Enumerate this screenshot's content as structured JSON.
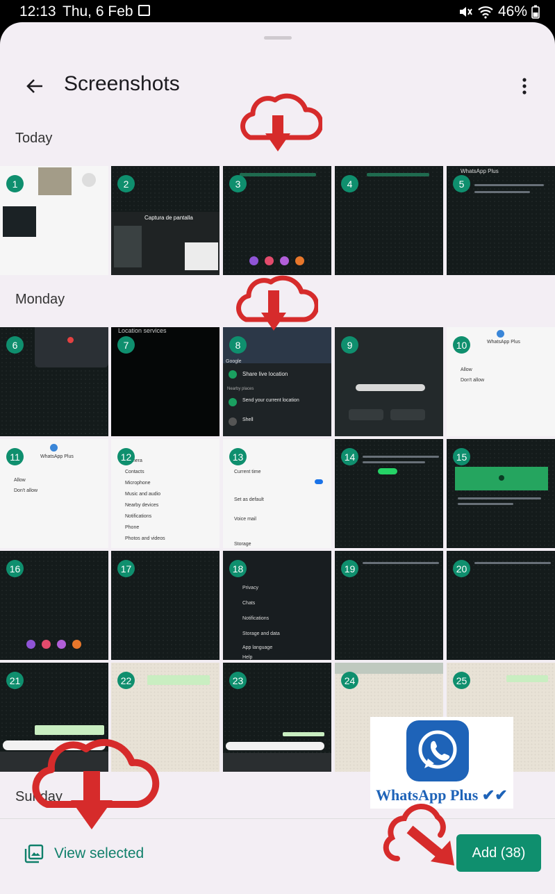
{
  "status_bar": {
    "time": "12:13",
    "date": "Thu, 6 Feb",
    "battery": "46%",
    "icons": [
      "gallery-icon",
      "mute-icon",
      "wifi-icon",
      "battery-icon"
    ]
  },
  "header": {
    "title": "Screenshots",
    "back_icon": "arrow-left-icon",
    "menu_icon": "more-vertical-icon"
  },
  "sections": [
    {
      "label": "Today"
    },
    {
      "label": "Monday"
    },
    {
      "label": "Sunday"
    }
  ],
  "selected_numbers": [
    "1",
    "2",
    "3",
    "4",
    "5",
    "6",
    "7",
    "8",
    "9",
    "10",
    "11",
    "12",
    "13",
    "14",
    "15",
    "16",
    "17",
    "18",
    "19",
    "20",
    "21",
    "22",
    "23",
    "24",
    "25"
  ],
  "thumbnail_text": {
    "t2_title": "Captura de pantalla",
    "t5_title": "WhatsApp Plus",
    "t7_title": "Location services",
    "t8_google": "Google",
    "t8_share": "Share live location",
    "t8_nearby": "Nearby places",
    "t8_send": "Send your current location",
    "t8_shell": "Shell",
    "t10_title": "WhatsApp Plus",
    "t10_allow": "Allow",
    "t10_dont": "Don't allow",
    "t11_title": "WhatsApp Plus",
    "t11_allow": "Allow",
    "t11_dont": "Don't allow",
    "t12_camera": "Camera",
    "t12_contacts": "Contacts",
    "t12_micro": "Microphone",
    "t12_music": "Music and audio",
    "t12_nearby": "Nearby devices",
    "t12_notif": "Notifications",
    "t12_phone": "Phone",
    "t12_photos": "Photos and videos",
    "t13_current": "Current time",
    "t13_set": "Set as default",
    "t13_voice": "Voice mail",
    "t13_storage": "Storage",
    "t18_privacy": "Privacy",
    "t18_chats": "Chats",
    "t18_notif": "Notifications",
    "t18_storage": "Storage and data",
    "t18_lang": "App language",
    "t18_help": "Help"
  },
  "watermark": {
    "brand": "WhatsApp Plus"
  },
  "bottom_bar": {
    "view_selected": "View selected",
    "add_button": "Add (38)"
  },
  "colors": {
    "accent": "#0f8f6e",
    "sheet_bg": "#f3eef4",
    "cloud_red": "#d62b2b"
  }
}
